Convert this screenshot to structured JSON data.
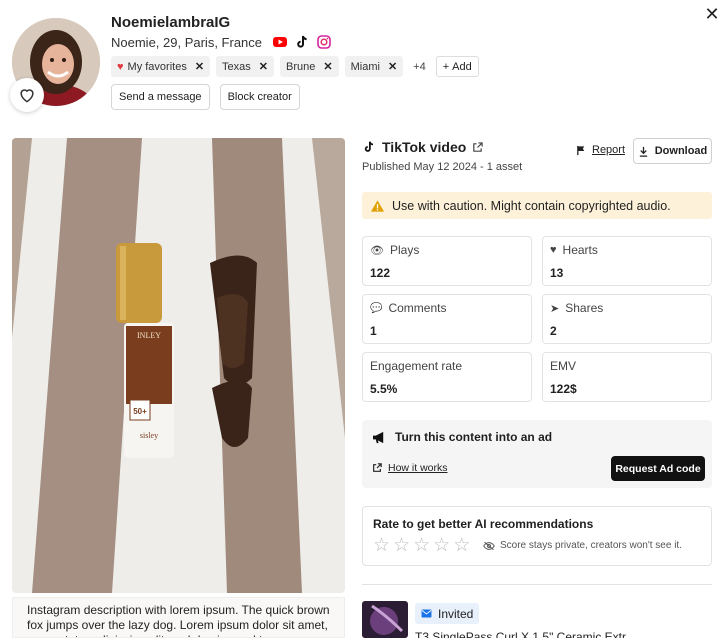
{
  "header": {
    "username": "NoemielambraIG",
    "subtitle": "Noemie, 29, Paris, France",
    "close_icon": "close-icon",
    "tags": [
      {
        "label": "My favorites",
        "icon": "heart-icon"
      },
      {
        "label": "Texas"
      },
      {
        "label": "Brune"
      },
      {
        "label": "Miami"
      }
    ],
    "more_tags": "+4",
    "add_label": "Add",
    "send_message": "Send a message",
    "block_creator": "Block creator"
  },
  "post": {
    "title": "TikTok video",
    "published": "Published May 12 2024 - 1 asset",
    "report": "Report",
    "download": "Download",
    "warning": "Use with caution. Might contain copyrighted audio.",
    "description": "Instagram description with lorem ipsum. The quick brown fox jumps over the lazy dog. Lorem ipsum dolor sit amet, consectetur adipiscing elit, sed do eiusmod tempor."
  },
  "stats": [
    {
      "label": "Plays",
      "value": "122",
      "icon": "eye-icon"
    },
    {
      "label": "Hearts",
      "value": "13",
      "icon": "heart-icon"
    },
    {
      "label": "Comments",
      "value": "1",
      "icon": "comment-icon"
    },
    {
      "label": "Shares",
      "value": "2",
      "icon": "share-icon"
    },
    {
      "label": "Engagement rate",
      "value": "5.5%"
    },
    {
      "label": "EMV",
      "value": "122$"
    }
  ],
  "ad": {
    "title": "Turn this content into an ad",
    "how": "How it works",
    "button": "Request Ad code"
  },
  "rating": {
    "title": "Rate to get better AI recommendations",
    "note": "Score stays private, creators won't see it.",
    "stars": 5
  },
  "product": {
    "status": "Invited",
    "name": "T3 SinglePass Curl X 1.5\" Ceramic Extr"
  },
  "colors": {
    "warning_bg": "#fdf2d9",
    "invited_bg": "#e7f0fb",
    "youtube": "#ff0000",
    "favorite": "#e03a3e"
  }
}
